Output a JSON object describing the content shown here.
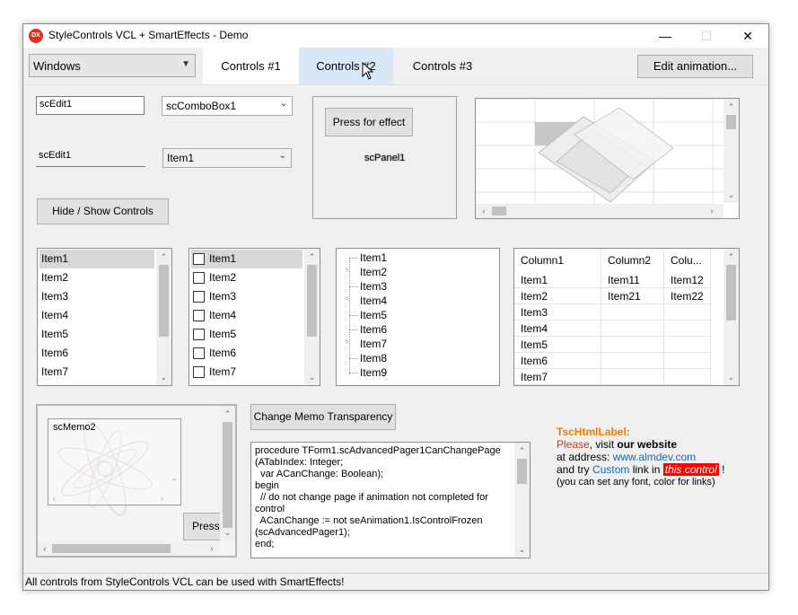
{
  "window": {
    "title": "StyleControls VCL + SmartEffects - Demo",
    "icon_text": "DX",
    "minimize_glyph": "—",
    "maximize_glyph": "☐",
    "close_glyph": "✕"
  },
  "toolbar": {
    "style_combo": "Windows",
    "tabs": [
      "Controls #1",
      "Controls #2",
      "Controls #3"
    ],
    "active_tab": "Controls #1",
    "hover_tab": "Controls #2",
    "edit_animation": "Edit animation..."
  },
  "edits": {
    "edit1": "scEdit1",
    "edit2": "scEdit1",
    "combo1": "scComboBox1",
    "combo2": "Item1"
  },
  "hide_show_button": "Hide / Show Controls",
  "panel": {
    "button": "Press for effect",
    "label": "scPanel1"
  },
  "listbox": [
    "Item1",
    "Item2",
    "Item3",
    "Item4",
    "Item5",
    "Item6",
    "Item7"
  ],
  "checklist": [
    "Item1",
    "Item2",
    "Item3",
    "Item4",
    "Item5",
    "Item6",
    "Item7"
  ],
  "tree": [
    {
      "label": "Item1",
      "expandable": false
    },
    {
      "label": "Item2",
      "expandable": true
    },
    {
      "label": "Item3",
      "expandable": false
    },
    {
      "label": "Item4",
      "expandable": true
    },
    {
      "label": "Item5",
      "expandable": false
    },
    {
      "label": "Item6",
      "expandable": false
    },
    {
      "label": "Item7",
      "expandable": true
    },
    {
      "label": "Item8",
      "expandable": false
    },
    {
      "label": "Item9",
      "expandable": false
    }
  ],
  "grid": {
    "headers": [
      "Column1",
      "Column2",
      "Colu..."
    ],
    "rows": [
      [
        "Item1",
        "Item11",
        "Item12"
      ],
      [
        "Item2",
        "Item21",
        "Item22"
      ],
      [
        "Item3",
        "",
        ""
      ],
      [
        "Item4",
        "",
        ""
      ],
      [
        "Item5",
        "",
        ""
      ],
      [
        "Item6",
        "",
        ""
      ],
      [
        "Item7",
        "",
        ""
      ]
    ]
  },
  "memo_panel": {
    "inner_memo_label": "scMemo2",
    "press_button": "Press f"
  },
  "change_memo_button": "Change Memo Transparency",
  "code_memo": "procedure TForm1.scAdvancedPager1CanChangePage\n(ATabIndex: Integer;\n  var ACanChange: Boolean);\nbegin\n  // do not change page if animation not completed for\ncontrol\n  ACanChange := not seAnimation1.IsControlFrozen\n(scAdvancedPager1);\nend;",
  "html_label": {
    "title": "TscHtmlLabel:",
    "please": "Please",
    "visit": ", visit ",
    "our_website": "our website",
    "at_address": "at address: ",
    "url": "www.almdev.com",
    "and_try": "and try ",
    "custom": "Custom",
    "link_in": " link in ",
    "this_control": "this control",
    "excl": " !",
    "note": "(you can set any font, color for links)",
    "colors": {
      "title": "#f07d00",
      "please": "#e0301e",
      "link": "#1a66b3",
      "highlight_bg": "#ff0000"
    }
  },
  "status": "All controls from StyleControls VCL can be used with SmartEffects!"
}
